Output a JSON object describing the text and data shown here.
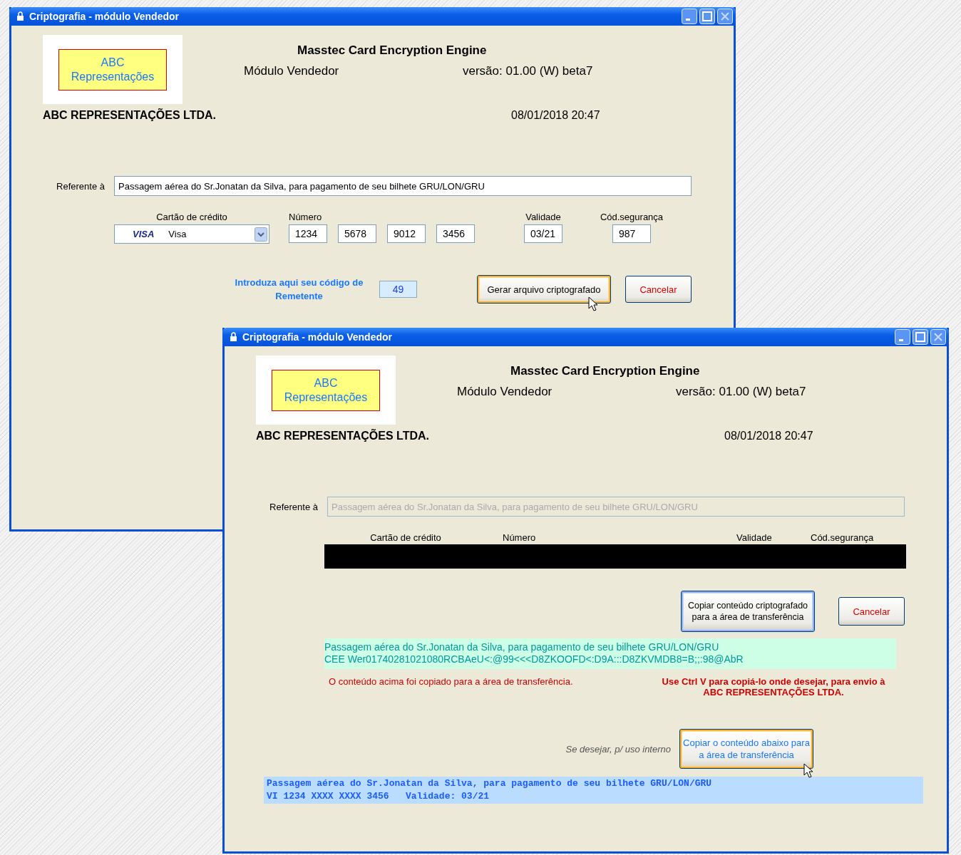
{
  "windows": [
    {
      "kind": "form",
      "title": "Criptografia - módulo Vendedor",
      "logo": {
        "line1": "ABC",
        "line2": "Representações"
      },
      "app_name": "Masstec Card Encryption Engine",
      "module": "Módulo Vendedor",
      "version": "versão: 01.00 (W)  beta7",
      "company": "ABC REPRESENTAÇÕES LTDA.",
      "datetime": "08/01/2018 20:47",
      "reference": {
        "label": "Referente à",
        "value": "Passagem aérea do Sr.Jonatan da Silva, para pagamento de seu bilhete GRU/LON/GRU",
        "disabled": false
      },
      "card": {
        "type_label": "Cartão de crédito",
        "brand": "VISA",
        "type_value": "Visa",
        "number_label": "Número",
        "number_groups": [
          "1234",
          "5678",
          "9012",
          "3456"
        ],
        "expiry_label": "Validade",
        "expiry": "03/21",
        "cvv_label": "Cód.segurança",
        "cvv": "987"
      },
      "sender": {
        "label": "Introduza aqui seu código de Remetente",
        "value": "49"
      },
      "buttons": [
        {
          "label": "Gerar arquivo criptografado",
          "kind": "action",
          "hovered": true,
          "focused": false
        },
        {
          "label": "Cancelar",
          "kind": "cancel",
          "hovered": false,
          "focused": false
        }
      ]
    },
    {
      "kind": "result",
      "title": "Criptografia - módulo Vendedor",
      "logo": {
        "line1": "ABC",
        "line2": "Representações"
      },
      "app_name": "Masstec Card Encryption Engine",
      "module": "Módulo Vendedor",
      "version": "versão: 01.00 (W)  beta7",
      "company": "ABC REPRESENTAÇÕES LTDA.",
      "datetime": "08/01/2018 20:47",
      "reference": {
        "label": "Referente à",
        "value": "Passagem aérea do Sr.Jonatan da Silva, para pagamento de seu bilhete GRU/LON/GRU",
        "disabled": true
      },
      "card_columns": [
        "Cartão de crédito",
        "Número",
        "Validade",
        "Cód.segurança"
      ],
      "buttons": [
        {
          "label": "Copiar conteúdo criptografado para a área de transferência",
          "kind": "action",
          "hovered": false,
          "focused": true
        },
        {
          "label": "Cancelar",
          "kind": "cancel",
          "hovered": false,
          "focused": false
        }
      ],
      "encrypted_lines": [
        "Passagem aérea do Sr.Jonatan da Silva, para pagamento de seu bilhete GRU/LON/GRU",
        "CEE Wer01740281021080RCBAeU<:@99<<<D8ZKOOFD<:D9A:::D8ZKVMDB8=B;;:98@AbR"
      ],
      "copied_message": "O conteúdo acima foi copiado para a área de transferência.",
      "instruction": "Use Ctrl V para copiá-lo onde desejar, para envio à ABC REPRESENTAÇÕES LTDA.",
      "internal": {
        "hint": "Se desejar, p/ uso interno",
        "button": {
          "label": "Copiar o conteúdo abaixo para a área de transferência",
          "hovered": true,
          "focused": false
        },
        "lines": [
          "Passagem aérea do Sr.Jonatan da Silva, para pagamento de seu bilhete GRU/LON/GRU",
          "VI 1234 XXXX XXXX 3456   Validade: 03/21"
        ]
      }
    }
  ]
}
